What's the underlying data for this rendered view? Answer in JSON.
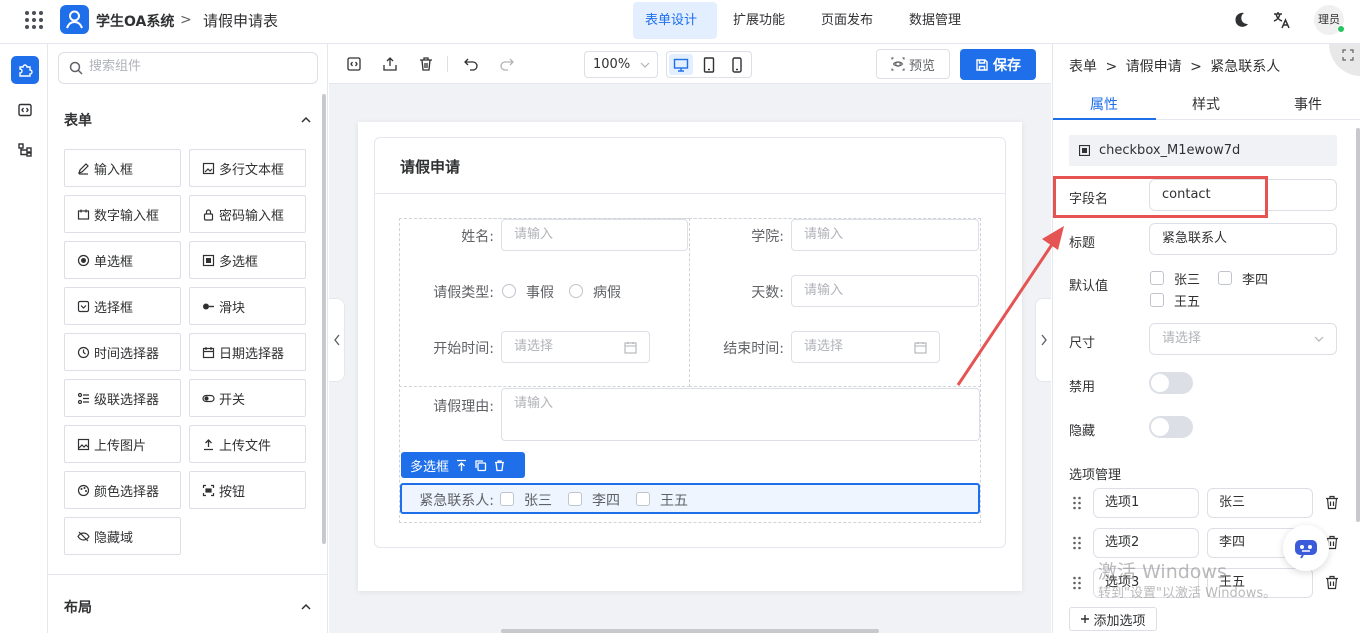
{
  "header": {
    "brand": "学生OA系统",
    "separator": ">",
    "page_title": "请假申请表",
    "nav": [
      "表单设计",
      "扩展功能",
      "页面发布",
      "数据管理"
    ],
    "active_nav": "表单设计",
    "avatar_text": "理员"
  },
  "components": {
    "search_placeholder": "搜索组件",
    "form_section_title": "表单",
    "items": [
      "输入框",
      "多行文本框",
      "数字输入框",
      "密码输入框",
      "单选框",
      "多选框",
      "选择框",
      "滑块",
      "时间选择器",
      "日期选择器",
      "级联选择器",
      "开关",
      "上传图片",
      "上传文件",
      "颜色选择器",
      "按钮",
      "隐藏域"
    ],
    "layout_section_title": "布局"
  },
  "toolbar": {
    "zoom": "100%",
    "preview_label": "预览",
    "save_label": "保存"
  },
  "form": {
    "title": "请假申请",
    "fields": {
      "name_label": "姓名:",
      "name_placeholder": "请输入",
      "college_label": "学院:",
      "college_placeholder": "请输入",
      "leave_type_label": "请假类型:",
      "leave_type_options": [
        "事假",
        "病假"
      ],
      "days_label": "天数:",
      "days_placeholder": "请输入",
      "start_label": "开始时间:",
      "start_placeholder": "请选择",
      "end_label": "结束时间:",
      "end_placeholder": "请选择",
      "reason_label": "请假理由:",
      "reason_placeholder": "请输入",
      "contact_label": "紧急联系人:",
      "contact_options": [
        "张三",
        "李四",
        "王五"
      ]
    },
    "selected_tag": "多选框"
  },
  "props": {
    "breadcrumb": [
      "表单",
      "请假申请",
      "紧急联系人"
    ],
    "tabs": [
      "属性",
      "样式",
      "事件"
    ],
    "active_tab": "属性",
    "component_id": "checkbox_M1ewow7d",
    "field_name_label": "字段名",
    "field_name_value": "contact",
    "title_label": "标题",
    "title_value": "紧急联系人",
    "default_label": "默认值",
    "default_options": [
      "张三",
      "李四",
      "王五"
    ],
    "size_label": "尺寸",
    "size_placeholder": "请选择",
    "disabled_label": "禁用",
    "hidden_label": "隐藏",
    "options_title": "选项管理",
    "options": [
      {
        "label": "选项1",
        "value": "张三"
      },
      {
        "label": "选项2",
        "value": "李四"
      },
      {
        "label": "选项3",
        "value": "王五"
      }
    ],
    "add_option_label": "添加选项"
  },
  "watermark": {
    "line1": "激活 Windows",
    "line2": "转到\"设置\"以激活 Windows。"
  },
  "colors": {
    "primary": "#1f6feb",
    "annotation": "#e55353"
  }
}
